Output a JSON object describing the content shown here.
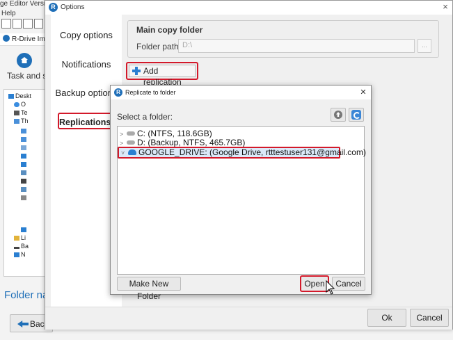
{
  "background_app": {
    "title": "ge Editor Version",
    "menu": "Help",
    "tab": "R-Drive Ima",
    "home_label": "Task and sc",
    "tree_items": [
      "Deskt",
      "O",
      "Te",
      "Th",
      "",
      "",
      "",
      "",
      "",
      "",
      "",
      "",
      "",
      "",
      "",
      "Li",
      "Ba",
      "N"
    ],
    "folder_name_label": "Folder na",
    "back_button": "Back"
  },
  "options_dialog": {
    "title": "Options",
    "nav": {
      "copy_options": "Copy options",
      "notifications": "Notifications",
      "backup_options": "Backup options",
      "replications": "Replications"
    },
    "main_copy_folder": {
      "title": "Main copy folder",
      "folder_path_label": "Folder path:",
      "folder_path_value": "D:\\",
      "browse_label": "..."
    },
    "add_replication_label": "Add replication",
    "ok_label": "Ok",
    "cancel_label": "Cancel"
  },
  "replicate_dialog": {
    "title": "Replicate to folder",
    "select_label": "Select a folder:",
    "drives": [
      {
        "label": "C: (NTFS, 118.6GB)",
        "icon": "drive-icon"
      },
      {
        "label": "D: (Backup, NTFS, 465.7GB)",
        "icon": "drive-icon"
      },
      {
        "label": "GOOGLE_DRIVE: (Google Drive, rtttestuser131@gmail.com)",
        "icon": "cloud-icon"
      }
    ],
    "make_folder_label": "Make New Folder",
    "open_label": "Open",
    "cancel_label": "Cancel"
  },
  "colors": {
    "accent": "#1f6fb8",
    "highlight_box": "#d3192a",
    "dialog_bg": "#f0f0f0"
  }
}
